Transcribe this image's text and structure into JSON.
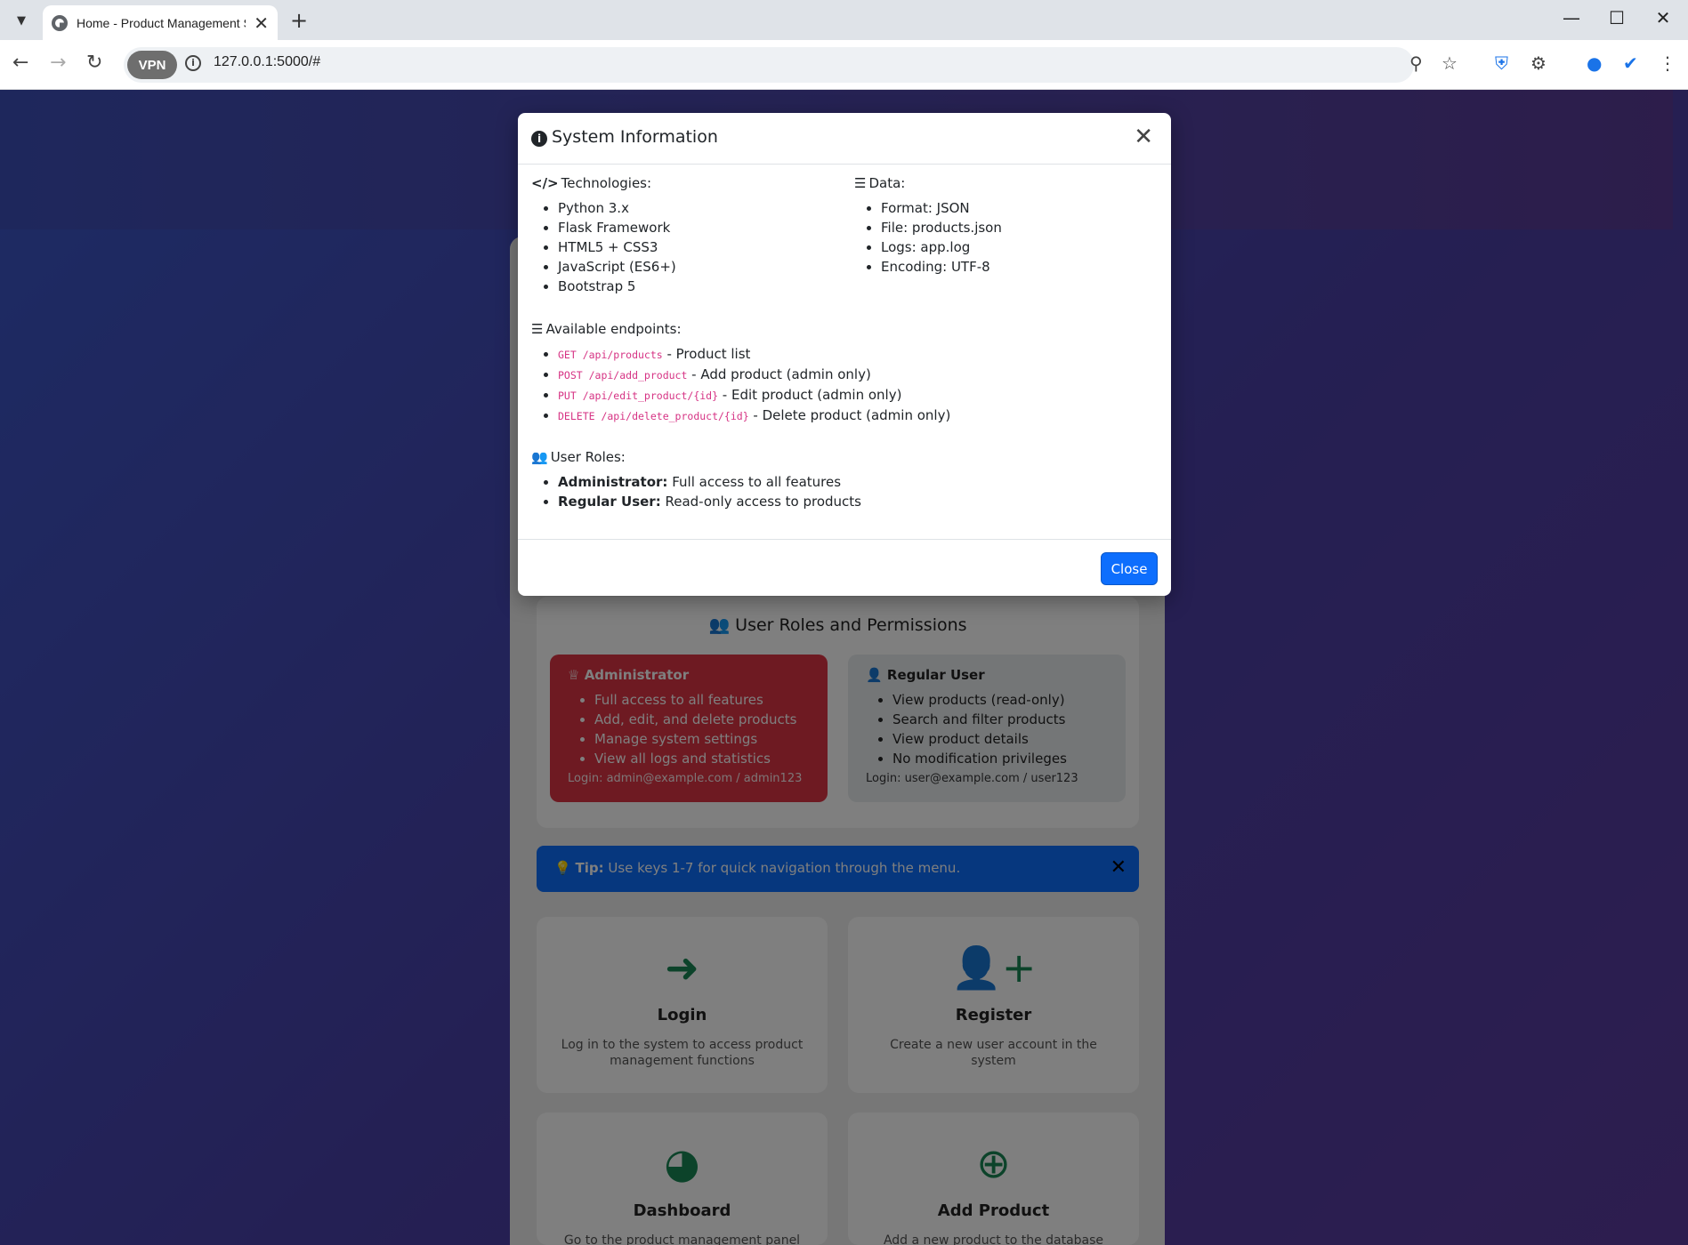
{
  "browser": {
    "tab_title": "Home - Product Management System",
    "url": "127.0.0.1:5000/#",
    "vpn_label": "VPN"
  },
  "roles_section": {
    "title": "User Roles and Permissions",
    "admin": {
      "title": "Administrator",
      "items": [
        "Full access to all features",
        "Add, edit, and delete products",
        "Manage system settings",
        "View all logs and statistics"
      ],
      "login": "Login: admin@example.com / admin123"
    },
    "user": {
      "title": "Regular User",
      "items": [
        "View products (read-only)",
        "Search and filter products",
        "View product details",
        "No modification privileges"
      ],
      "login": "Login: user@example.com / user123"
    }
  },
  "tip": {
    "label": "Tip:",
    "text": " Use keys 1-7 for quick navigation through the menu."
  },
  "actions": [
    {
      "title": "Login",
      "desc": "Log in to the system to access product management functions",
      "icon": "login-icon"
    },
    {
      "title": "Register",
      "desc": "Create a new user account in the system",
      "icon": "user-plus-icon"
    },
    {
      "title": "Dashboard",
      "desc": "Go to the product management panel",
      "icon": "dashboard-icon"
    },
    {
      "title": "Add Product",
      "desc": "Add a new product to the database",
      "icon": "plus-circle-icon"
    }
  ],
  "modal": {
    "title": "System Information",
    "technologies": {
      "title": "Technologies:",
      "items": [
        "Python 3.x",
        "Flask Framework",
        "HTML5 + CSS3",
        "JavaScript (ES6+)",
        "Bootstrap 5"
      ]
    },
    "data": {
      "title": "Data:",
      "items": [
        "Format: JSON",
        "File: products.json",
        "Logs: app.log",
        "Encoding: UTF-8"
      ]
    },
    "endpoints": {
      "title": "Available endpoints:",
      "items": [
        {
          "code": "GET /api/products",
          "desc": " - Product list"
        },
        {
          "code": "POST /api/add_product",
          "desc": " - Add product (admin only)"
        },
        {
          "code": "PUT /api/edit_product/{id}",
          "desc": " - Edit product (admin only)"
        },
        {
          "code": "DELETE /api/delete_product/{id}",
          "desc": " - Delete product (admin only)"
        }
      ]
    },
    "roles": {
      "title": "User Roles:",
      "items": [
        {
          "role": "Administrator:",
          "desc": " Full access to all features"
        },
        {
          "role": "Regular User:",
          "desc": " Read-only access to products"
        }
      ]
    },
    "close_label": "Close"
  },
  "colors": {
    "primary": "#0d6efd",
    "danger": "#dc3545",
    "success": "#198754",
    "code": "#d63384"
  }
}
